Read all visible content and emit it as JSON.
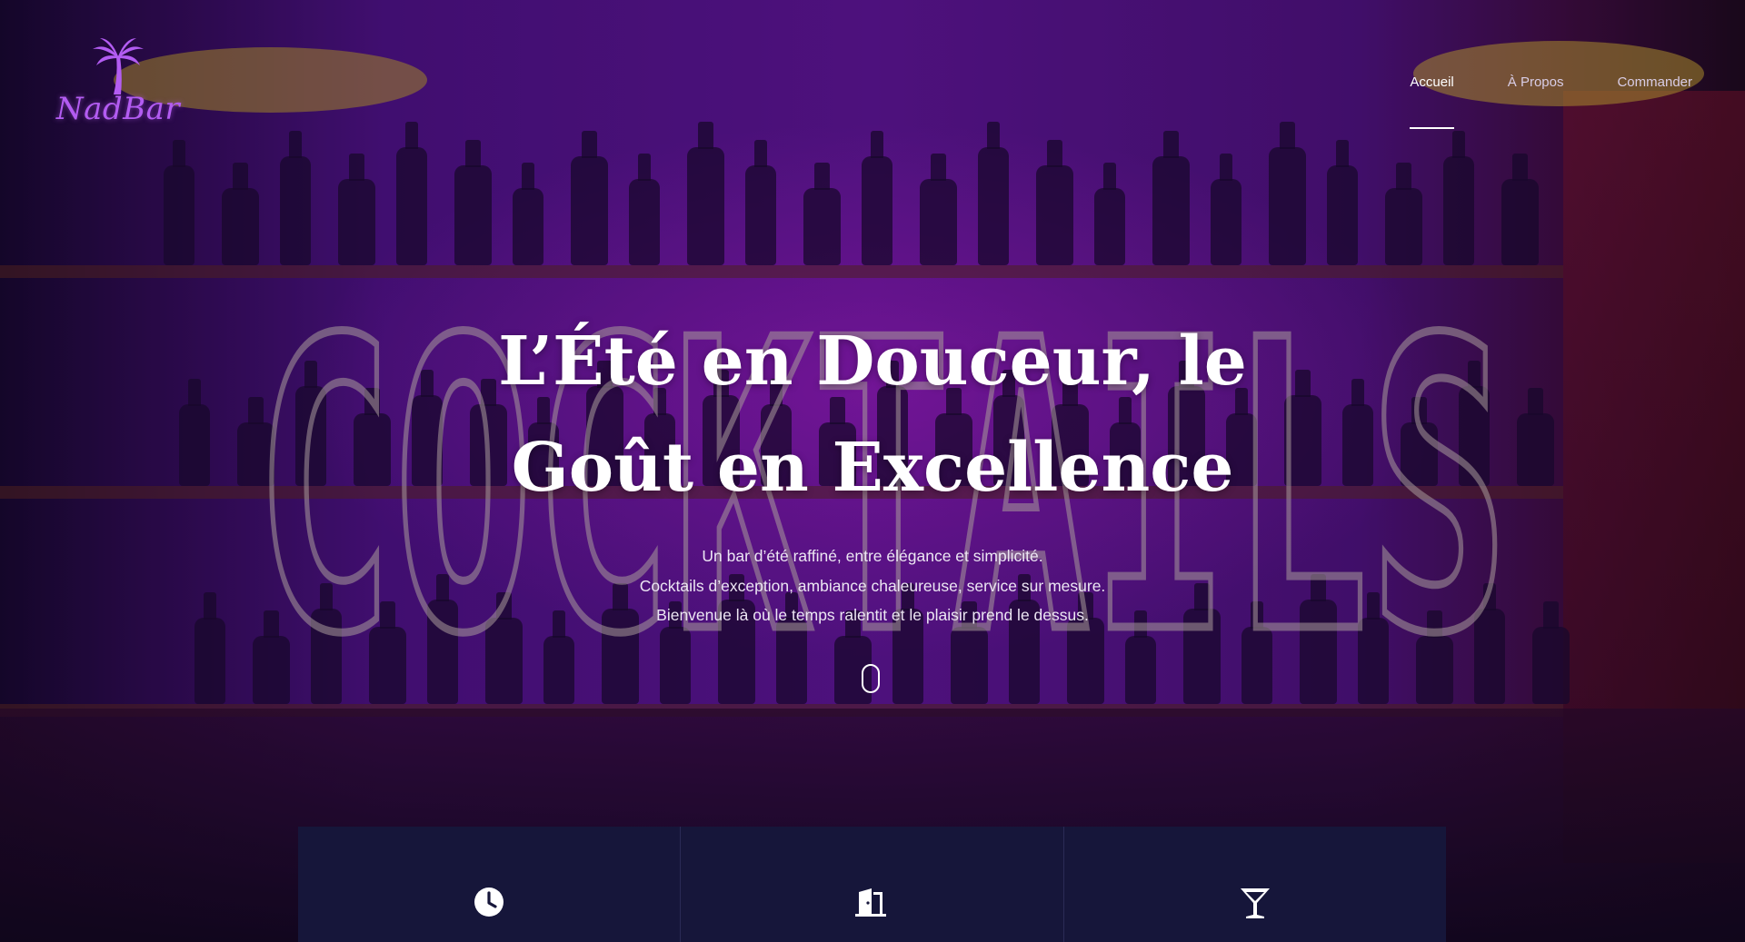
{
  "site": {
    "brand": "NadBar"
  },
  "nav": {
    "items": [
      {
        "label": "Accueil",
        "active": true
      },
      {
        "label": "À Propos",
        "active": false
      },
      {
        "label": "Commander",
        "active": false
      }
    ]
  },
  "hero": {
    "background_sign": "COCKTAILS",
    "title_lines": [
      "L’Été en Douceur, le",
      "Goût en Excellence"
    ],
    "subtitle_lines": [
      "Un bar d’été raffiné, entre élégance et simplicité.",
      "Cocktails d’exception, ambiance chaleureuse, service sur mesure.",
      "Bienvenue là où le temps ralentit et le plaisir prend le dessus."
    ]
  },
  "features": [
    {
      "icon": "clock-icon"
    },
    {
      "icon": "door-icon"
    },
    {
      "icon": "cocktail-glass-icon"
    }
  ],
  "colors": {
    "brand_purple": "#b35cf2",
    "feature_bg": "#16163a",
    "text_white": "#ffffff"
  }
}
